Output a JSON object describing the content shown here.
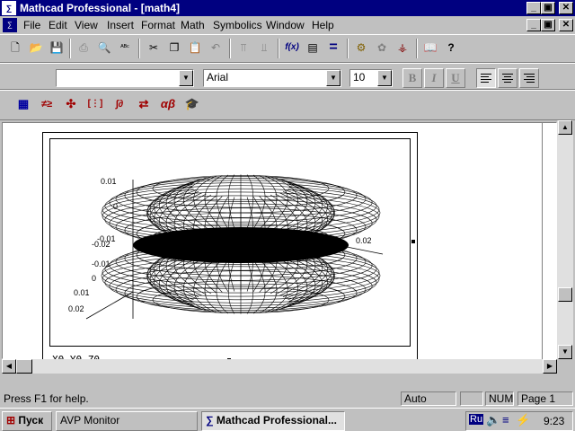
{
  "window": {
    "title": "Mathcad Professional - [math4]",
    "minimize_glyph": "_",
    "restore_glyph": "▣",
    "close_glyph": "✕"
  },
  "menubar": {
    "items": [
      {
        "label": "File"
      },
      {
        "label": "Edit"
      },
      {
        "label": "View"
      },
      {
        "label": "Insert"
      },
      {
        "label": "Format"
      },
      {
        "label": "Math"
      },
      {
        "label": "Symbolics"
      },
      {
        "label": "Window"
      },
      {
        "label": "Help"
      }
    ]
  },
  "toolbar": {
    "buttons": [
      {
        "icon": "new-icon",
        "glyph": "🗋"
      },
      {
        "icon": "open-icon",
        "glyph": "📂"
      },
      {
        "icon": "save-icon",
        "glyph": "💾"
      },
      {
        "icon": "print-icon",
        "glyph": "⎙",
        "disabled": true
      },
      {
        "icon": "print-preview-icon",
        "glyph": "🔍",
        "disabled": true
      },
      {
        "icon": "spell-check-icon",
        "glyph": "ᴬᴮᶜ"
      },
      {
        "icon": "cut-icon",
        "glyph": "✂"
      },
      {
        "icon": "copy-icon",
        "glyph": "❐"
      },
      {
        "icon": "paste-icon",
        "glyph": "📋",
        "disabled": true
      },
      {
        "icon": "undo-icon",
        "glyph": "↶",
        "disabled": true
      },
      {
        "icon": "align-top-icon",
        "glyph": "⫪",
        "disabled": true
      },
      {
        "icon": "align-bottom-icon",
        "glyph": "⫫",
        "disabled": true
      },
      {
        "icon": "insert-function-icon",
        "glyph": "f(x)"
      },
      {
        "icon": "insert-unit-icon",
        "glyph": "▤"
      },
      {
        "icon": "calculate-icon",
        "glyph": "="
      },
      {
        "icon": "component-icon",
        "glyph": "⚙"
      },
      {
        "icon": "resources-icon",
        "glyph": "✿"
      },
      {
        "icon": "component-wizard-icon",
        "glyph": "⚶"
      },
      {
        "icon": "reference-icon",
        "glyph": "📖"
      },
      {
        "icon": "help-icon",
        "glyph": "?"
      }
    ]
  },
  "format_bar": {
    "style_value": "",
    "font_value": "Arial",
    "size_value": "10",
    "bold_label": "B",
    "italic_label": "I",
    "underline_label": "U"
  },
  "math_palette": {
    "buttons": [
      {
        "icon": "calculator-palette-icon",
        "glyph": "▦"
      },
      {
        "icon": "boolean-palette-icon",
        "glyph": "≠≥"
      },
      {
        "icon": "graph-palette-icon",
        "glyph": "✣"
      },
      {
        "icon": "matrix-palette-icon",
        "glyph": "[⋮]"
      },
      {
        "icon": "calculus-palette-icon",
        "glyph": "∫∂"
      },
      {
        "icon": "programming-palette-icon",
        "glyph": "⇄"
      },
      {
        "icon": "greek-palette-icon",
        "glyph": "αβ"
      },
      {
        "icon": "symbolic-palette-icon",
        "glyph": "🎓"
      }
    ]
  },
  "plot": {
    "caption": "X0,Y0,Z0",
    "axis_labels": [
      {
        "text": "0.01"
      },
      {
        "text": "0"
      },
      {
        "text": "-0.01"
      },
      {
        "text": "-0.02"
      },
      {
        "text": "-0.01"
      },
      {
        "text": "0"
      },
      {
        "text": "0.01"
      },
      {
        "text": "0.02"
      },
      {
        "text": "0.02"
      }
    ]
  },
  "statusbar": {
    "help_text": "Press F1 for help.",
    "mode": "Auto",
    "num": "NUM",
    "page": "Page 1"
  },
  "taskbar": {
    "start_label": "Пуск",
    "tasks": [
      {
        "label": "AVP Monitor",
        "active": false
      },
      {
        "label": "Mathcad Professional...",
        "active": true
      }
    ],
    "lang": "Ru",
    "clock": "9:23"
  },
  "colors": {
    "titlebar": "#000080",
    "face": "#c0c0c0",
    "document": "#ffffff"
  }
}
